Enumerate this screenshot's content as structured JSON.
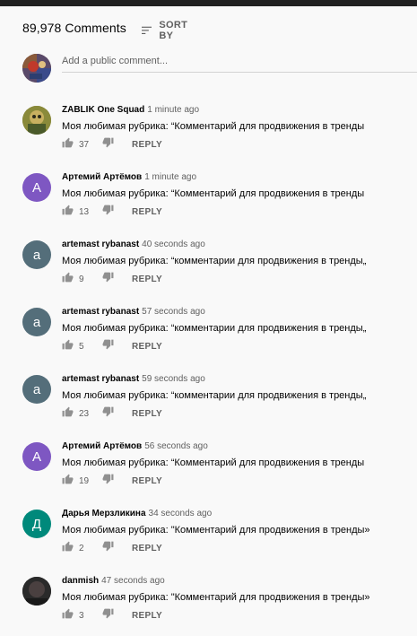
{
  "header": {
    "comment_count": "89,978 Comments",
    "sort_label": "SORT BY"
  },
  "add_comment": {
    "placeholder": "Add a public comment..."
  },
  "actions": {
    "reply_label": "REPLY"
  },
  "colors": {
    "purple": "#7e57c2",
    "slate": "#546e7a",
    "teal": "#00897b",
    "gray_text": "#606060"
  },
  "comments": [
    {
      "author": "ZABLIK One Squad",
      "time": "1 minute ago",
      "text": "Моя любимая рубрика: “Комментарий для продвижения в тренды",
      "likes": "37",
      "avatar_letter": "",
      "avatar_color": "#7a7a2a"
    },
    {
      "author": "Артемий Артёмов",
      "time": "1 minute ago",
      "text": "Моя любимая рубрика: “Комментарий для продвижения в тренды",
      "likes": "13",
      "avatar_letter": "А",
      "avatar_color": "#7e57c2"
    },
    {
      "author": "artemast rybanast",
      "time": "40 seconds ago",
      "text": "Моя любимая рубрика: “комментарии для продвижения в тренды„",
      "likes": "9",
      "avatar_letter": "a",
      "avatar_color": "#546e7a"
    },
    {
      "author": "artemast rybanast",
      "time": "57 seconds ago",
      "text": "Моя любимая рубрика: “комментарии для продвижения в тренды„",
      "likes": "5",
      "avatar_letter": "a",
      "avatar_color": "#546e7a"
    },
    {
      "author": "artemast rybanast",
      "time": "59 seconds ago",
      "text": "Моя любимая рубрика: “комментарии для продвижения в тренды„",
      "likes": "23",
      "avatar_letter": "a",
      "avatar_color": "#546e7a"
    },
    {
      "author": "Артемий Артёмов",
      "time": "56 seconds ago",
      "text": "Моя любимая рубрика: “Комментарий для продвижения в тренды",
      "likes": "19",
      "avatar_letter": "А",
      "avatar_color": "#7e57c2"
    },
    {
      "author": "Дарья Мерзликина",
      "time": "34 seconds ago",
      "text": "Моя любимая рубрика: \"Комментарий для продвижения в тренды»",
      "likes": "2",
      "avatar_letter": "Д",
      "avatar_color": "#00897b"
    },
    {
      "author": "danmish",
      "time": "47 seconds ago",
      "text": "Моя любимая рубрика: \"Комментарий для продвижения в тренды»",
      "likes": "3",
      "avatar_letter": "",
      "avatar_color": "#3a3a3a"
    }
  ]
}
